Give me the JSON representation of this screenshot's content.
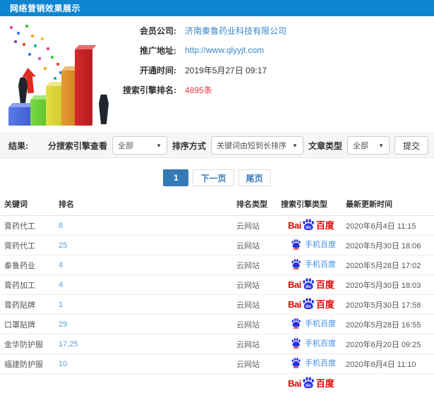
{
  "header": {
    "title": "网络营销效果展示"
  },
  "info": {
    "rows": [
      {
        "label": "会员公司:",
        "value": "济南秦鲁药业科技有限公司",
        "type": "link"
      },
      {
        "label": "推广地址:",
        "value": "http://www.qlyyjt.com",
        "type": "link"
      },
      {
        "label": "开通时间:",
        "value": "2019年5月27日 09:17",
        "type": "text"
      },
      {
        "label": "搜索引擎排名:",
        "value": "4895条",
        "type": "highlight"
      }
    ]
  },
  "filters": {
    "result_label": "结果:",
    "engine_label": "分搜索引擎查看",
    "engine_value": "全部",
    "sort_label": "排序方式",
    "sort_value": "关键词由短到长排序",
    "article_label": "文章类型",
    "article_value": "全部",
    "submit_label": "提交",
    "caret": "▼"
  },
  "pagination": {
    "current": "1",
    "next": "下一页",
    "last": "尾页"
  },
  "table": {
    "headers": [
      "关键词",
      "排名",
      "排名类型",
      "搜索引擎类型",
      "最新更新时间"
    ],
    "rows": [
      {
        "keyword": "膏药代工",
        "rank": "8",
        "rank_type": "云网站",
        "engine": "baidu",
        "time": "2020年6月4日 11:15"
      },
      {
        "keyword": "膏药代工",
        "rank": "25",
        "rank_type": "云网站",
        "engine": "mobile-baidu",
        "time": "2020年5月30日 18:06"
      },
      {
        "keyword": "秦鲁药业",
        "rank": "4",
        "rank_type": "云网站",
        "engine": "mobile-baidu",
        "time": "2020年5月28日 17:02"
      },
      {
        "keyword": "膏药加工",
        "rank": "4",
        "rank_type": "云网站",
        "engine": "baidu",
        "time": "2020年5月30日 18:03"
      },
      {
        "keyword": "膏药贴牌",
        "rank": "1",
        "rank_type": "云网站",
        "engine": "baidu",
        "time": "2020年5月30日 17:58"
      },
      {
        "keyword": "口罩贴牌",
        "rank": "29",
        "rank_type": "云网站",
        "engine": "mobile-baidu",
        "time": "2020年5月28日 16:55"
      },
      {
        "keyword": "金华防护服",
        "rank": "17,25",
        "rank_type": "云网站",
        "engine": "mobile-baidu",
        "time": "2020年6月20日 09:25"
      },
      {
        "keyword": "福建防护服",
        "rank": "10",
        "rank_type": "云网站",
        "engine": "mobile-baidu",
        "time": "2020年6月4日 11:10"
      }
    ],
    "partial_row": {
      "engine": "baidu"
    },
    "baidu_logo": {
      "bai": "Bai",
      "du": "du",
      "cn": "百度"
    },
    "mobile_baidu_label": "手机百度"
  },
  "colors": {
    "header_bg": "#0d85d0",
    "link_blue": "#3a87c8",
    "rank_blue": "#58a0dd",
    "highlight_red": "#e4393c",
    "baidu_red": "#e10601",
    "baidu_blue": "#2932e1",
    "mobile_blue": "#3c8ce6",
    "pagination_active": "#337ab7"
  }
}
